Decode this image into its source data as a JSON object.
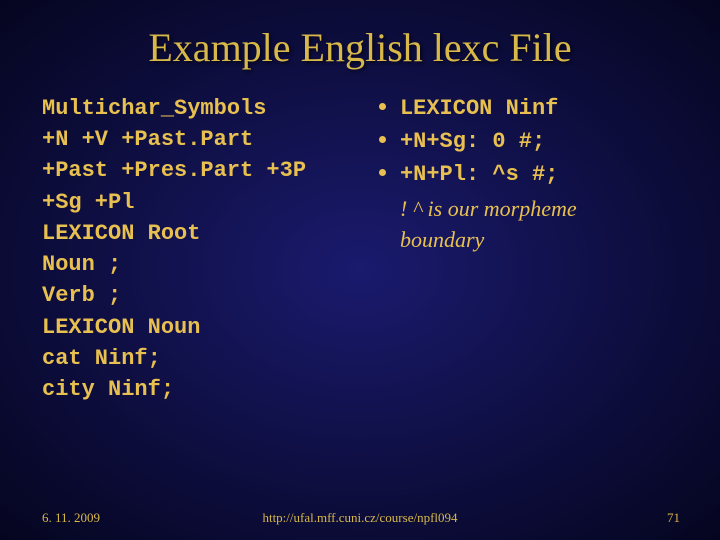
{
  "title": "Example English lexc File",
  "left": {
    "l1": "Multichar_Symbols",
    "l2": "+N +V +Past.Part",
    "l3": "+Past +Pres.Part +3P",
    "l4": "+Sg +Pl",
    "l5": "LEXICON Root",
    "l6": "Noun ;",
    "l7": "Verb ;",
    "l8": "LEXICON Noun",
    "l9": "cat  Ninf;",
    "l10": "city Ninf;"
  },
  "right": {
    "b1": "LEXICON Ninf",
    "b2": "+N+Sg: 0  #;",
    "b3": "+N+Pl: ^s #;",
    "comment1": "! ^ is our morpheme",
    "comment2": "boundary"
  },
  "footer": {
    "date": "6. 11. 2009",
    "url": "http://ufal.mff.cuni.cz/course/npfl094",
    "page": "71"
  }
}
